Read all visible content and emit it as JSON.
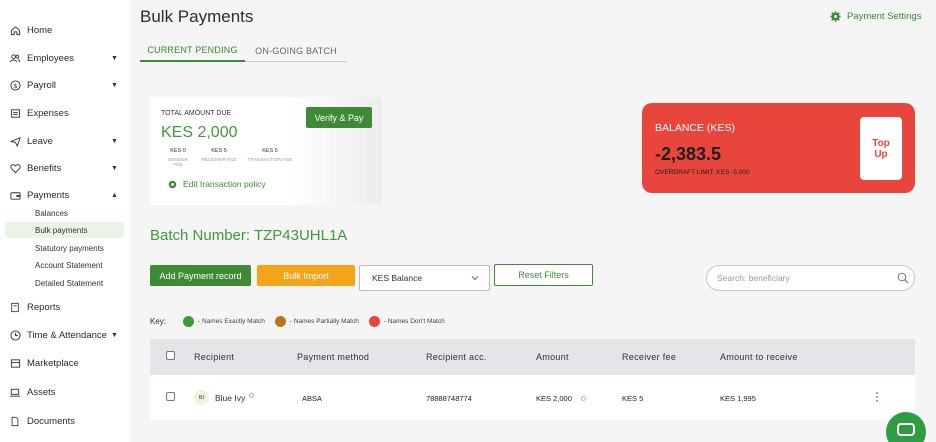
{
  "sidebar": {
    "items": [
      {
        "label": "Home",
        "icon": "home-icon"
      },
      {
        "label": "Employees",
        "icon": "users-icon"
      },
      {
        "label": "Payroll",
        "icon": "dollar-icon"
      },
      {
        "label": "Expenses",
        "icon": "receipt-icon"
      },
      {
        "label": "Leave",
        "icon": "plane-icon"
      },
      {
        "label": "Benefits",
        "icon": "heart-icon"
      },
      {
        "label": "Payments",
        "icon": "wallet-icon"
      },
      {
        "label": "Reports",
        "icon": "document-icon"
      },
      {
        "label": "Time & Attendance",
        "icon": "clock-icon"
      },
      {
        "label": "Marketplace",
        "icon": "store-icon"
      },
      {
        "label": "Assets",
        "icon": "laptop-icon"
      },
      {
        "label": "Documents",
        "icon": "file-icon"
      }
    ],
    "payments_sub": [
      "Balances",
      "Bulk payments",
      "Statutory payments",
      "Account Statement",
      "Detailed Statement"
    ]
  },
  "header": {
    "title": "Bulk Payments",
    "settings_label": "Payment Settings"
  },
  "tabs": [
    "CURRENT PENDING",
    "ON-GOING BATCH"
  ],
  "amount_card": {
    "label": "TOTAL AMOUNT DUE",
    "value": "KES 2,000",
    "fees": [
      {
        "value": "KES 0",
        "label": "SENDER FEE"
      },
      {
        "value": "KES 5",
        "label": "RECEIVER FEE"
      },
      {
        "value": "KES 5",
        "label": "TRANSACTION FEE"
      }
    ],
    "verify_label": "Verify & Pay",
    "edit_policy_label": "Edit transaction policy"
  },
  "balance_card": {
    "label": "BALANCE (KES)",
    "value": "-2,383.5",
    "overdraft": "OVERDRAFT LIMIT: KES -5,000",
    "topup_line1": "Top",
    "topup_line2": "Up"
  },
  "batch_number": "Batch Number: TZP43UHL1A",
  "actions": {
    "add_label": "Add Payment record",
    "bulk_label": "Bulk Import",
    "select_value": "KES Balance",
    "reset_label": "Reset Filters",
    "search_placeholder": "Search: beneficiary"
  },
  "key": {
    "label": "Key:",
    "items": [
      {
        "label": "- Names Exactly Match",
        "color": "#3e9a3a"
      },
      {
        "label": "- Names Partially Match",
        "color": "#b27a1c"
      },
      {
        "label": "- Names Don't Match",
        "color": "#e8463c"
      }
    ]
  },
  "table": {
    "columns": [
      "Recipient",
      "Payment method",
      "Recipient acc.",
      "Amount",
      "Receiver fee",
      "Amount to receive"
    ],
    "rows": [
      {
        "initials": "BI",
        "recipient": "Blue Ivy",
        "method": "ABSA",
        "account": "78888748774",
        "amount": "KES 2,000",
        "fee": "KES 5",
        "receive": "KES 1,995"
      }
    ]
  }
}
